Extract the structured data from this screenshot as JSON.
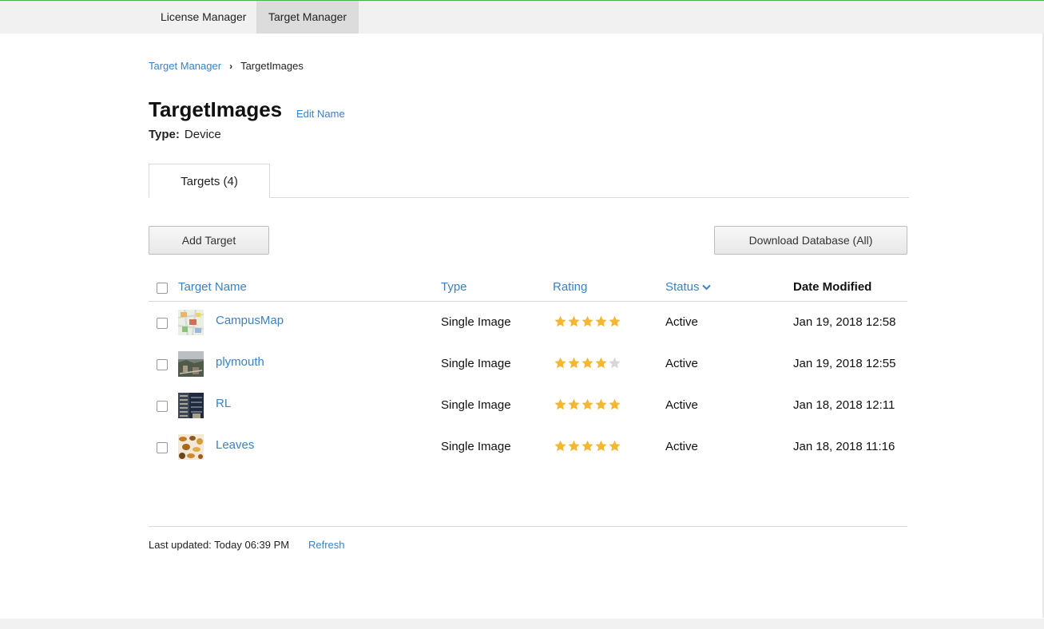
{
  "topnav": {
    "tabs": [
      {
        "label": "License Manager"
      },
      {
        "label": "Target Manager"
      }
    ]
  },
  "breadcrumb": {
    "parent": "Target Manager",
    "separator": "›",
    "current": "TargetImages"
  },
  "page": {
    "title": "TargetImages",
    "edit_label": "Edit Name",
    "type_label": "Type:",
    "type_value": "Device"
  },
  "tabs": {
    "targets_label": "Targets (4)"
  },
  "toolbar": {
    "add_label": "Add Target",
    "download_label": "Download Database (All)"
  },
  "table": {
    "headers": {
      "name": "Target Name",
      "type": "Type",
      "rating": "Rating",
      "status": "Status",
      "date": "Date Modified"
    },
    "rows": [
      {
        "name": "CampusMap",
        "type": "Single Image",
        "rating": 5,
        "status": "Active",
        "date": "Jan 19, 2018 12:58"
      },
      {
        "name": "plymouth",
        "type": "Single Image",
        "rating": 4,
        "status": "Active",
        "date": "Jan 19, 2018 12:55"
      },
      {
        "name": "RL",
        "type": "Single Image",
        "rating": 5,
        "status": "Active",
        "date": "Jan 18, 2018 12:11"
      },
      {
        "name": "Leaves",
        "type": "Single Image",
        "rating": 5,
        "status": "Active",
        "date": "Jan 18, 2018 11:16"
      }
    ]
  },
  "footer": {
    "last_updated": "Last updated: Today 06:39 PM",
    "refresh_label": "Refresh"
  },
  "colors": {
    "link": "#3b82c4",
    "star_on": "#f5b731",
    "star_off": "#d6d6d6",
    "accent_line": "#4caf50"
  }
}
